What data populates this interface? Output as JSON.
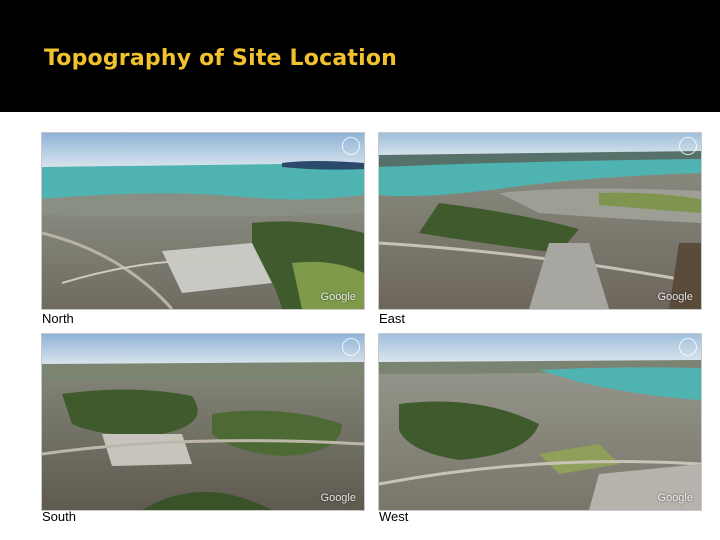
{
  "slide": {
    "title": "Topography of Site Location"
  },
  "views": [
    {
      "caption": "North"
    },
    {
      "caption": "East"
    },
    {
      "caption": "South"
    },
    {
      "caption": "West"
    }
  ],
  "map_credit": "Google",
  "colors": {
    "title": "#f2c12e",
    "title_bar": "#000000",
    "sky": "#a9c4de",
    "water": "#4fb3b1",
    "vegetation": "#3f5a2c",
    "urban": "#9a9a92"
  }
}
